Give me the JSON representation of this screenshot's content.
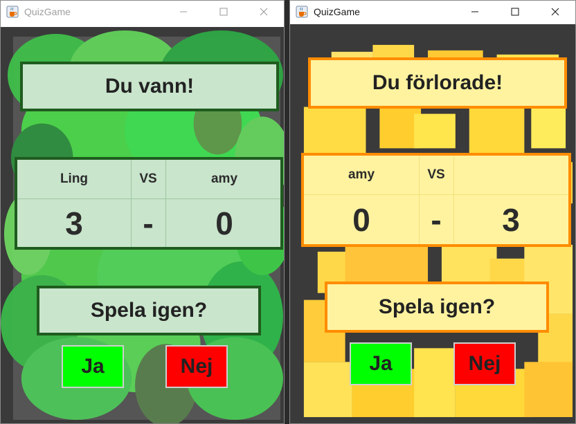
{
  "windows": [
    {
      "title": "QuizGame",
      "result": "Du vann!",
      "player_left": "Ling",
      "vs": "VS",
      "player_right": "amy",
      "score_left": "3",
      "dash": "-",
      "score_right": "0",
      "play_again": "Spela igen?",
      "yes": "Ja",
      "no": "Nej",
      "theme": {
        "fill": "#c9e5cc",
        "border": "#1f5c1f"
      },
      "active": false
    },
    {
      "title": "QuizGame",
      "result": "Du förlorade!",
      "player_left": "amy",
      "vs": "VS",
      "player_right": "",
      "score_left": "0",
      "dash": "-",
      "score_right": "3",
      "play_again": "Spela igen?",
      "yes": "Ja",
      "no": "Nej",
      "theme": {
        "fill": "#fff3a0",
        "border": "#ff8c00"
      },
      "active": true
    }
  ],
  "colors": {
    "yes_button": "#00ff00",
    "no_button": "#ff0000"
  },
  "icons": {
    "app": "java-cup-icon",
    "minimize": "minimize-icon",
    "maximize": "maximize-icon",
    "close": "close-icon"
  }
}
